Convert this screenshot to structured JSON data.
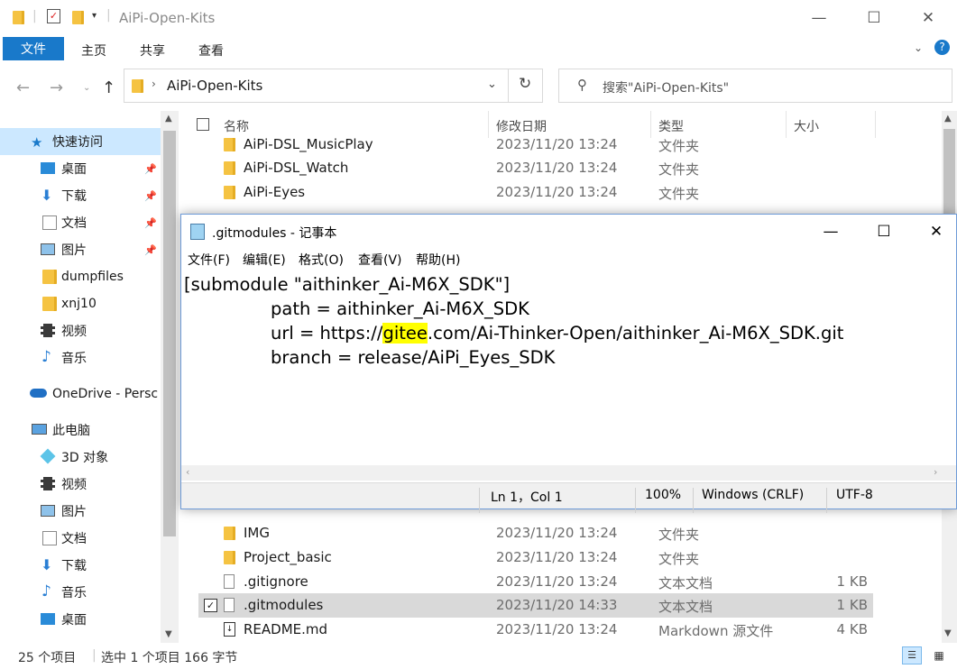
{
  "explorer": {
    "title": "AiPi-Open-Kits",
    "ribbon_tabs": [
      "文件",
      "主页",
      "共享",
      "查看"
    ],
    "address": "AiPi-Open-Kits",
    "search_placeholder": "搜索\"AiPi-Open-Kits\"",
    "nav": {
      "quick_access": "快速访问",
      "items": [
        "桌面",
        "下载",
        "文档",
        "图片",
        "dumpfiles",
        "xnj10",
        "视频",
        "音乐"
      ],
      "onedrive": "OneDrive - Persc",
      "this_pc": "此电脑",
      "pc_items": [
        "3D 对象",
        "视频",
        "图片",
        "文档",
        "下载",
        "音乐",
        "桌面"
      ]
    },
    "columns": {
      "name": "名称",
      "date": "修改日期",
      "type": "类型",
      "size": "大小"
    },
    "files_top": [
      {
        "name": "AiPi-DSL_MusicPlay",
        "date": "2023/11/20 13:24",
        "type": "文件夹",
        "size": ""
      },
      {
        "name": "AiPi-DSL_Watch",
        "date": "2023/11/20 13:24",
        "type": "文件夹",
        "size": ""
      },
      {
        "name": "AiPi-Eyes",
        "date": "2023/11/20 13:24",
        "type": "文件夹",
        "size": ""
      }
    ],
    "files_bottom": [
      {
        "name": "IMG",
        "date": "2023/11/20 13:24",
        "type": "文件夹",
        "size": ""
      },
      {
        "name": "Project_basic",
        "date": "2023/11/20 13:24",
        "type": "文件夹",
        "size": ""
      },
      {
        "name": ".gitignore",
        "date": "2023/11/20 13:24",
        "type": "文本文档",
        "size": "1 KB"
      },
      {
        "name": ".gitmodules",
        "date": "2023/11/20 14:33",
        "type": "文本文档",
        "size": "1 KB"
      },
      {
        "name": "README.md",
        "date": "2023/11/20 13:24",
        "type": "Markdown 源文件",
        "size": "4 KB"
      }
    ],
    "status": {
      "count": "25 个项目",
      "selected": "选中 1 个项目  166 字节"
    }
  },
  "notepad": {
    "title": ".gitmodules - 记事本",
    "menu": [
      "文件(F)",
      "编辑(E)",
      "格式(O)",
      "查看(V)",
      "帮助(H)"
    ],
    "lines": {
      "l1": "[submodule \"aithinker_Ai-M6X_SDK\"]",
      "l2": "\tpath = aithinker_Ai-M6X_SDK",
      "l3a": "\turl = https://",
      "l3hl": "gitee",
      "l3b": ".com/Ai-Thinker-Open/aithinker_Ai-M6X_SDK.git",
      "l4": "\tbranch = release/AiPi_Eyes_SDK"
    },
    "status": {
      "position": "Ln 1，Col 1",
      "zoom": "100%",
      "eol": "Windows (CRLF)",
      "encoding": "UTF-8"
    }
  }
}
